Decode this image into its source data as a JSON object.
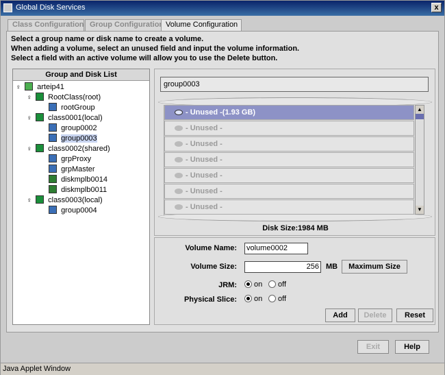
{
  "window": {
    "title": "Global Disk Services",
    "close_glyph": "x"
  },
  "tabs": [
    {
      "label": "Class Configuration"
    },
    {
      "label": "Group Configuration"
    },
    {
      "label": "Volume Configuration"
    }
  ],
  "instructions": [
    "Select a group name or disk name to create a volume.",
    "When adding a volume, select an unused field and input the volume information.",
    "Select a field with an active volume will allow you to use the Delete button."
  ],
  "tree": {
    "header": "Group and Disk List",
    "nodes": [
      {
        "label": "arteip41"
      },
      {
        "label": "RootClass(root)"
      },
      {
        "label": "rootGroup"
      },
      {
        "label": "class0001(local)"
      },
      {
        "label": "group0002"
      },
      {
        "label": "group0003"
      },
      {
        "label": "class0002(shared)"
      },
      {
        "label": "grpProxy"
      },
      {
        "label": "grpMaster"
      },
      {
        "label": "diskmplb0014"
      },
      {
        "label": "diskmplb0011"
      },
      {
        "label": "class0003(local)"
      },
      {
        "label": "group0004"
      }
    ],
    "pin_glyph": "♀"
  },
  "volume_panel": {
    "group_name": "group0003",
    "volumes": [
      {
        "label": "- Unused -(1.93 GB)"
      },
      {
        "label": "- Unused -"
      },
      {
        "label": "- Unused -"
      },
      {
        "label": "- Unused -"
      },
      {
        "label": "- Unused -"
      },
      {
        "label": "- Unused -"
      },
      {
        "label": "- Unused -"
      }
    ],
    "disk_size": "Disk Size:1984 MB",
    "scroll_up": "▲",
    "scroll_down": "▼"
  },
  "form": {
    "volume_name_label": "Volume Name:",
    "volume_name_value": "volume0002",
    "volume_size_label": "Volume Size:",
    "volume_size_value": "256",
    "unit": "MB",
    "max_size_button": "Maximum Size",
    "jrm_label": "JRM:",
    "jrm_on": "on",
    "jrm_off": "off",
    "physical_slice_label": "Physical Slice:",
    "ps_on": "on",
    "ps_off": "off",
    "add_button": "Add",
    "delete_button": "Delete",
    "reset_button": "Reset"
  },
  "bottom": {
    "exit_button": "Exit",
    "help_button": "Help"
  },
  "status": "Java Applet Window"
}
